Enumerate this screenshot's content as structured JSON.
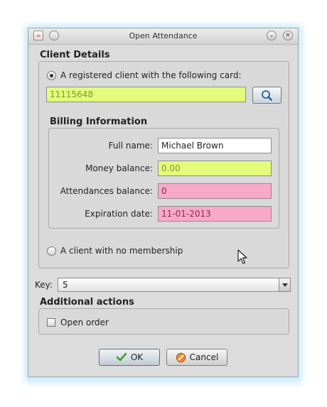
{
  "window": {
    "title": "Open Attendance"
  },
  "client_details": {
    "title": "Client Details",
    "registered_option": "A registered client with the following card:",
    "card_number": "11115648",
    "no_membership_option": "A client with no membership"
  },
  "billing": {
    "title": "Billing Information",
    "full_name_label": "Full name:",
    "full_name_value": "Michael Brown",
    "money_balance_label": "Money balance:",
    "money_balance_value": "0.00",
    "attendances_balance_label": "Attendances balance:",
    "attendances_balance_value": "0",
    "expiration_date_label": "Expiration date:",
    "expiration_date_value": "11-01-2013"
  },
  "key": {
    "label": "Key:",
    "value": "5"
  },
  "additional_actions": {
    "title": "Additional actions",
    "open_order_label": "Open order"
  },
  "buttons": {
    "ok_label": "OK",
    "cancel_label": "Cancel"
  },
  "colors": {
    "valid_field": "#e4fb7c",
    "invalid_field": "#f9a9c8",
    "valid_text": "#7e9a2e",
    "invalid_text": "#8a2b46"
  }
}
